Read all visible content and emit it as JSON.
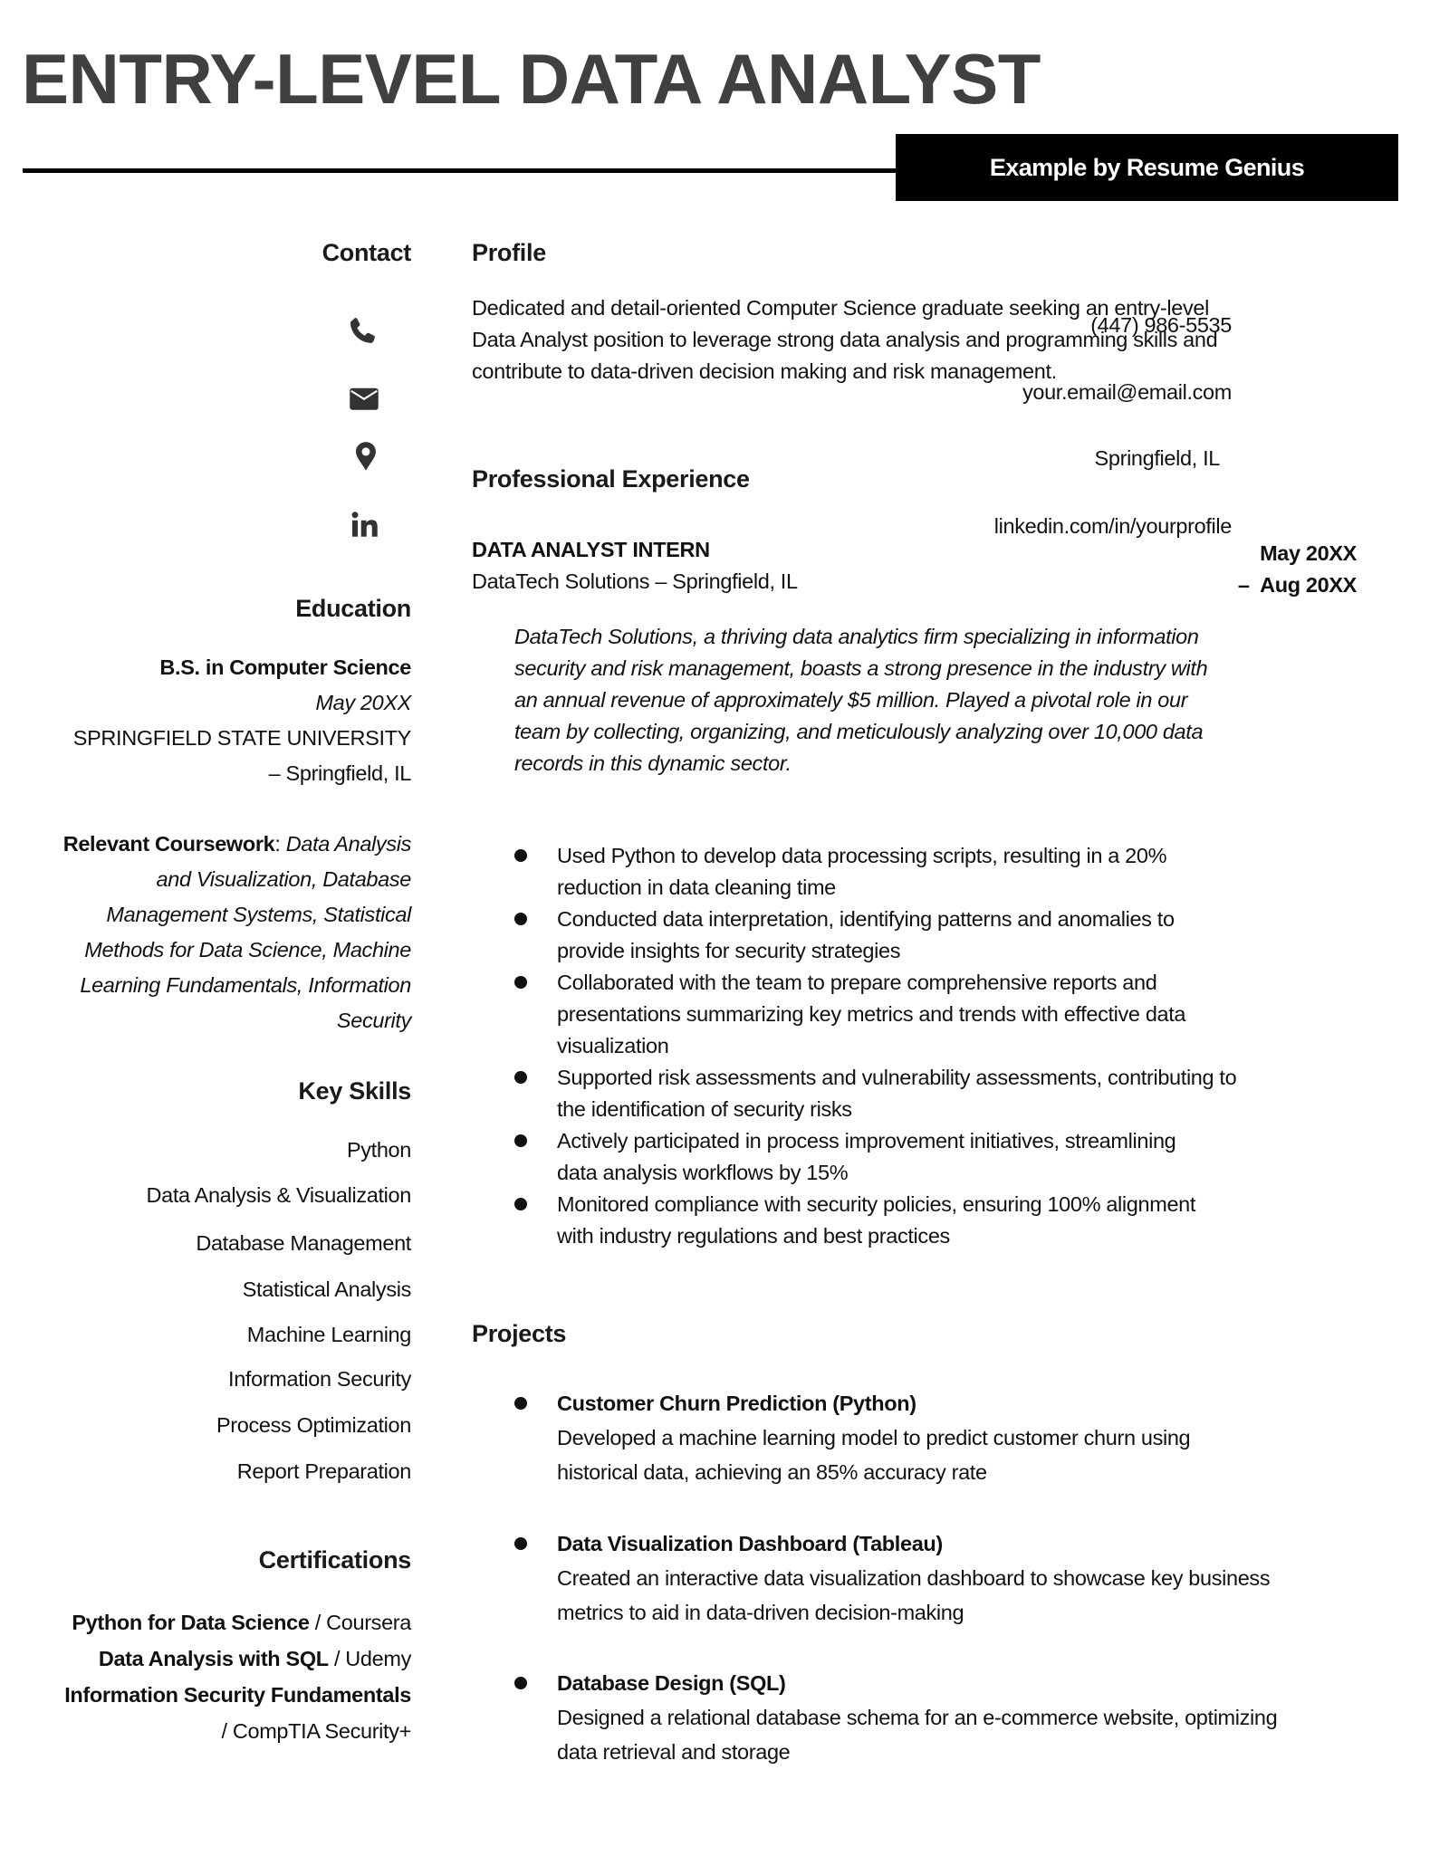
{
  "header": {
    "title": "ENTRY-LEVEL DATA ANALYST",
    "badge": "Example by Resume Genius"
  },
  "contact": {
    "heading": "Contact",
    "phone": "(447) 986-5535",
    "email": "your.email@email.com",
    "location": "Springfield, IL",
    "linkedin": "linkedin.com/in/yourprofile",
    "icons": [
      "phone-icon",
      "email-icon",
      "location-pin-icon",
      "linkedin-icon"
    ]
  },
  "education": {
    "heading": "Education",
    "degree": "B.S. in Computer Science",
    "date": "May 20XX",
    "school": "SPRINGFIELD STATE UNIVERSITY",
    "location": "– Springfield, IL",
    "coursework_label": "Relevant Coursework",
    "coursework_lines": [
      ": ",
      "Data Analysis",
      "and Visualization, Database",
      "Management Systems, Statistical",
      "Methods for Data Science, Machine",
      "Learning Fundamentals, Information",
      "Security"
    ]
  },
  "skills": {
    "heading": "Key Skills",
    "items": [
      "Python",
      "Data Analysis & Visualization",
      "Database Management",
      "Statistical Analysis",
      "Machine Learning",
      "Information Security",
      "Process Optimization",
      "Report Preparation"
    ]
  },
  "certifications": {
    "heading": "Certifications",
    "items": [
      {
        "name": "Python for Data Science",
        "issuer": " / Coursera"
      },
      {
        "name": "Data Analysis with SQL",
        "issuer": " / Udemy"
      },
      {
        "name": "Information Security Fundamentals",
        "issuer": ""
      }
    ],
    "last_issuer_line": "/ CompTIA Security+"
  },
  "profile": {
    "heading": "Profile",
    "lines": [
      "Dedicated and detail-oriented Computer Science graduate seeking an entry-level",
      "Data Analyst position to leverage strong data analysis and programming skills and",
      "contribute to data-driven decision making and risk management."
    ]
  },
  "experience": {
    "heading": "Professional Experience",
    "job": {
      "title": "DATA ANALYST INTERN",
      "company": "DataTech Solutions – Springfield, IL",
      "date_start": "May 20XX",
      "date_end": "–  Aug 20XX",
      "description_lines": [
        "DataTech Solutions, a thriving data analytics firm specializing in information",
        "security and risk management, boasts a strong presence in the industry with",
        "an annual revenue of approximately $5 million. Played a pivotal role in our",
        "team by collecting, organizing, and meticulously analyzing over 10,000 data",
        "records in this dynamic sector."
      ],
      "bullets": [
        [
          "Used Python to develop data processing scripts, resulting in a 20%",
          "reduction in data cleaning time"
        ],
        [
          "Conducted data interpretation, identifying patterns and anomalies to",
          "provide insights for security strategies"
        ],
        [
          "Collaborated with the team to prepare comprehensive reports and",
          "presentations summarizing key metrics and trends with effective data",
          "visualization"
        ],
        [
          "Supported risk assessments and vulnerability assessments, contributing to",
          "the identification of security risks"
        ],
        [
          "Actively participated in process improvement initiatives, streamlining",
          "data analysis workflows by 15%"
        ],
        [
          "Monitored compliance with security policies, ensuring 100% alignment",
          "with industry regulations and best practices"
        ]
      ]
    }
  },
  "projects": {
    "heading": "Projects",
    "items": [
      {
        "title": "Customer Churn Prediction (Python)",
        "lines": [
          "Developed a machine learning model to predict customer churn using",
          "historical data, achieving an 85% accuracy rate"
        ]
      },
      {
        "title": "Data Visualization Dashboard (Tableau)",
        "lines": [
          "Created an interactive data visualization dashboard to showcase key business",
          "metrics to aid in data-driven decision-making"
        ]
      },
      {
        "title": "Database Design (SQL)",
        "lines": [
          "Designed a relational database schema for an e-commerce website, optimizing",
          "data retrieval and storage"
        ]
      }
    ]
  }
}
